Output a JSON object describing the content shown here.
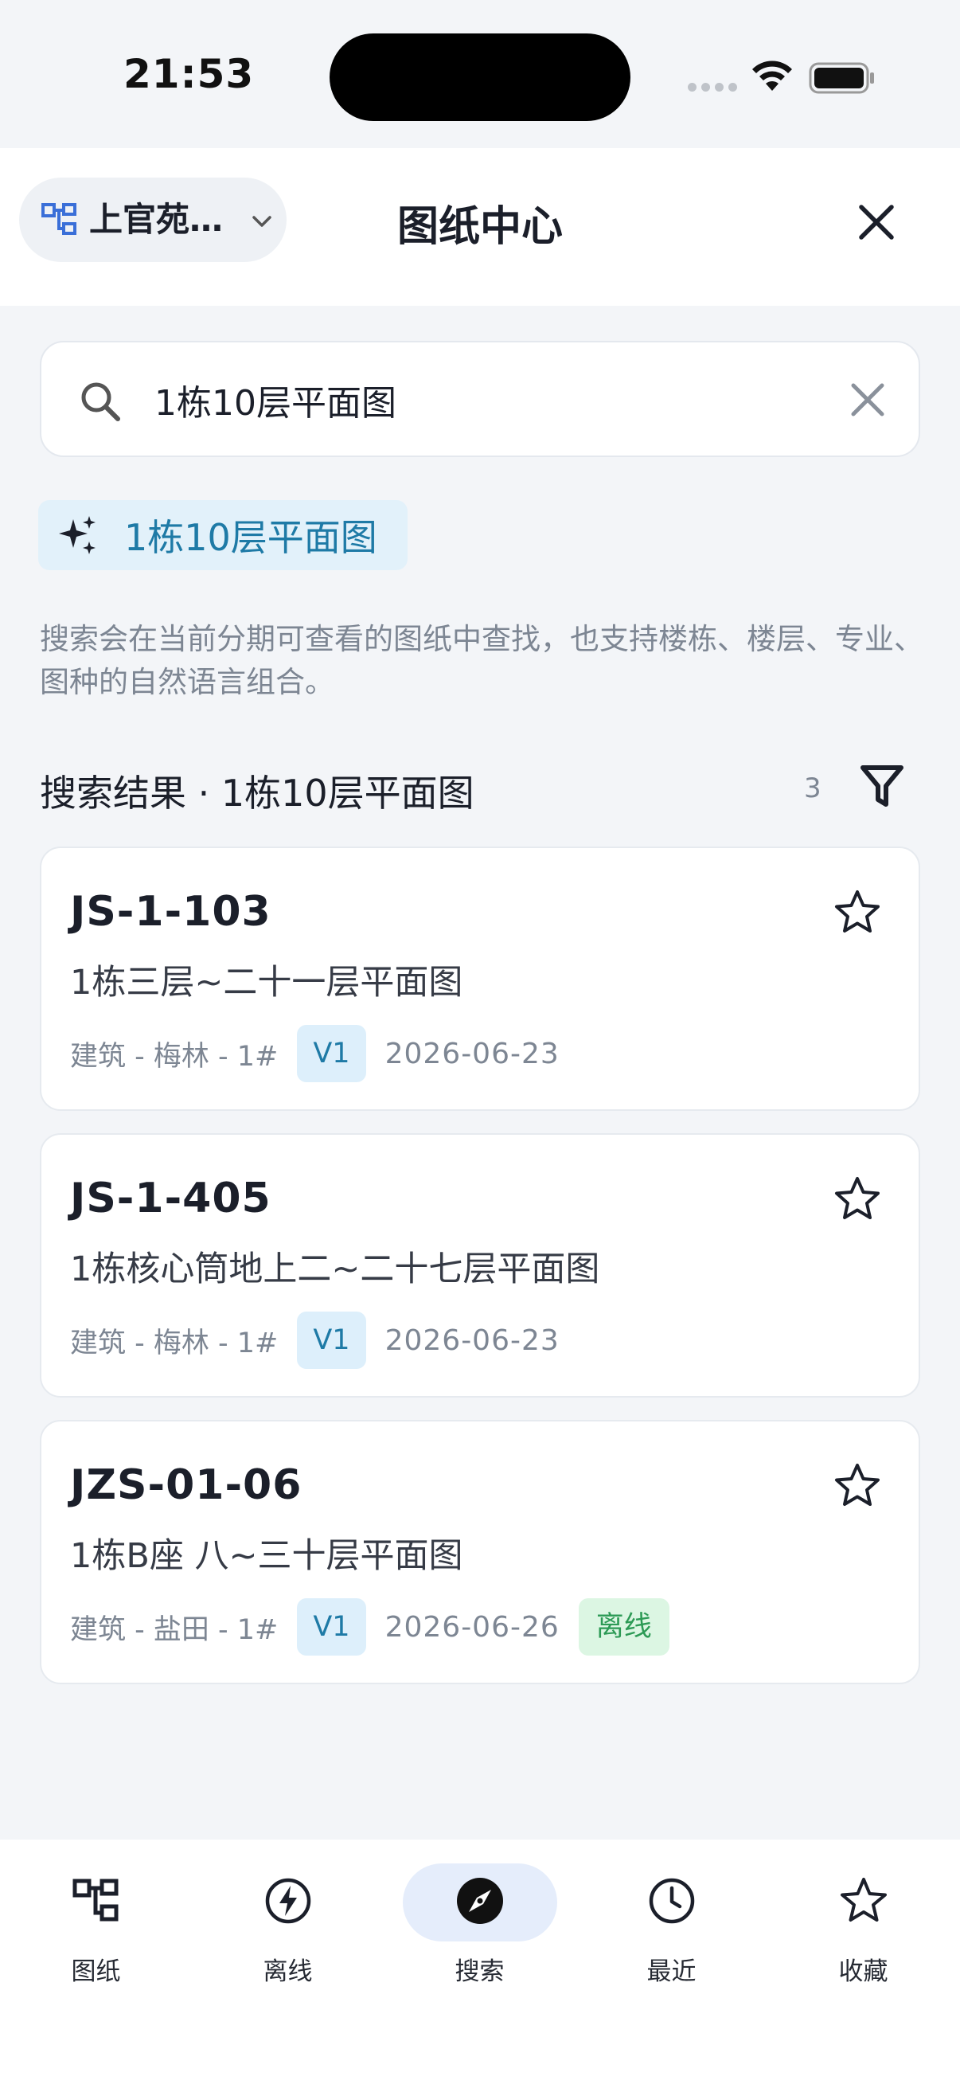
{
  "status_bar": {
    "time": "21:53"
  },
  "header": {
    "project": "上官苑…",
    "title": "图纸中心"
  },
  "search": {
    "value": "1栋10层平面图",
    "placeholder": ""
  },
  "suggestion_chip": {
    "label": "1栋10层平面图"
  },
  "hint": "搜索会在当前分期可查看的图纸中查找，也支持楼栋、楼层、专业、图种的自然语言组合。",
  "results": {
    "title": "搜索结果 · 1栋10层平面图",
    "count": "3",
    "items": [
      {
        "code": "JS-1-103",
        "desc": "1栋三层~二十一层平面图",
        "spec": "建筑 - 梅林 - 1#",
        "version": "V1",
        "date": "2026-06-23",
        "offline": ""
      },
      {
        "code": "JS-1-405",
        "desc": "1栋核心筒地上二~二十七层平面图",
        "spec": "建筑 - 梅林 - 1#",
        "version": "V1",
        "date": "2026-06-23",
        "offline": ""
      },
      {
        "code": "JZS-01-06",
        "desc": "1栋B座 八~三十层平面图",
        "spec": "建筑 - 盐田 - 1#",
        "version": "V1",
        "date": "2026-06-26",
        "offline": "离线"
      }
    ]
  },
  "tabbar": {
    "tabs": [
      {
        "label": "图纸",
        "icon": "blueprint-tree-icon"
      },
      {
        "label": "离线",
        "icon": "offline-bolt-icon"
      },
      {
        "label": "搜索",
        "icon": "compass-icon",
        "active": true
      },
      {
        "label": "最近",
        "icon": "clock-icon"
      },
      {
        "label": "收藏",
        "icon": "star-icon"
      }
    ]
  },
  "colors": {
    "accent": "#1e7aa6",
    "accent_bg": "#e2f1fa",
    "offline_green": "#2c9a55",
    "active_tab_bg": "#e5edfb",
    "brand_blue": "#3a6fd8"
  }
}
